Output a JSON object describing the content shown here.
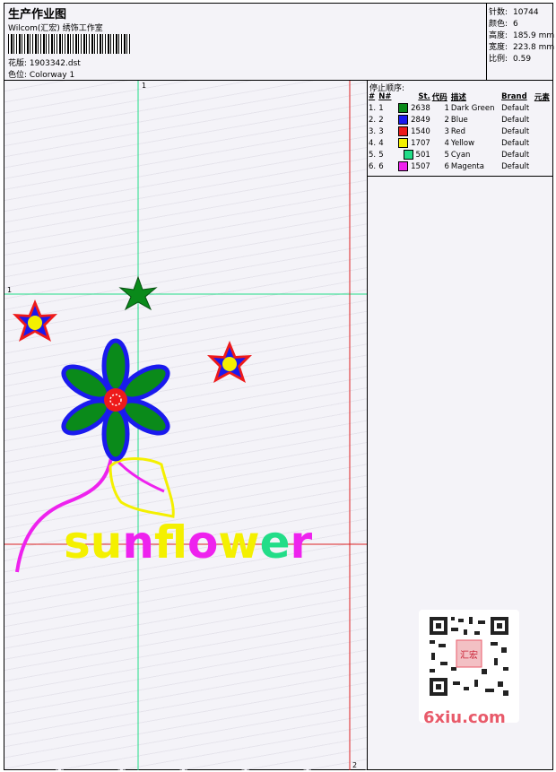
{
  "header": {
    "title": "生产作业图",
    "subtitle": "Wilcom(汇宏) 绣饰工作室",
    "file_label": "花版:",
    "file_value": "1903342.dst",
    "colorway_label": "色位:",
    "colorway_value": "Colorway 1"
  },
  "stats": [
    {
      "key": "针数:",
      "value": "10744"
    },
    {
      "key": "颜色:",
      "value": "6"
    },
    {
      "key": "高度:",
      "value": "185.9 mm"
    },
    {
      "key": "宽度:",
      "value": "223.8 mm"
    },
    {
      "key": "比例:",
      "value": "0.59"
    }
  ],
  "stops": {
    "title": "停止顺序:",
    "columns": [
      "#",
      "N#",
      "St.",
      "代码",
      "描述",
      "Brand",
      "元素"
    ],
    "rows": [
      {
        "idx": "1.",
        "n": "1",
        "st": "2638",
        "code": "1",
        "desc": "Dark Green",
        "brand": "Default",
        "color": "#0a8a1a"
      },
      {
        "idx": "2.",
        "n": "2",
        "st": "2849",
        "code": "2",
        "desc": "Blue",
        "brand": "Default",
        "color": "#1a1aee"
      },
      {
        "idx": "3.",
        "n": "3",
        "st": "1540",
        "code": "3",
        "desc": "Red",
        "brand": "Default",
        "color": "#ee1a1a"
      },
      {
        "idx": "4.",
        "n": "4",
        "st": "1707",
        "code": "4",
        "desc": "Yellow",
        "brand": "Default",
        "color": "#f4f000"
      },
      {
        "idx": "5.",
        "n": "5",
        "st": "501",
        "code": "5",
        "desc": "Cyan",
        "brand": "Default",
        "color": "#22dd88"
      },
      {
        "idx": "6.",
        "n": "6",
        "st": "1507",
        "code": "6",
        "desc": "Magenta",
        "brand": "Default",
        "color": "#ee22ee"
      }
    ]
  },
  "canvas": {
    "text": "sunflower",
    "guide_labels": {
      "top": "1",
      "left": "1",
      "bottom": "2"
    },
    "line_green": "#22dd88",
    "line_red": "#dd2222"
  },
  "watermark": {
    "text": "6xiu.com",
    "stamp": "汇宏"
  }
}
